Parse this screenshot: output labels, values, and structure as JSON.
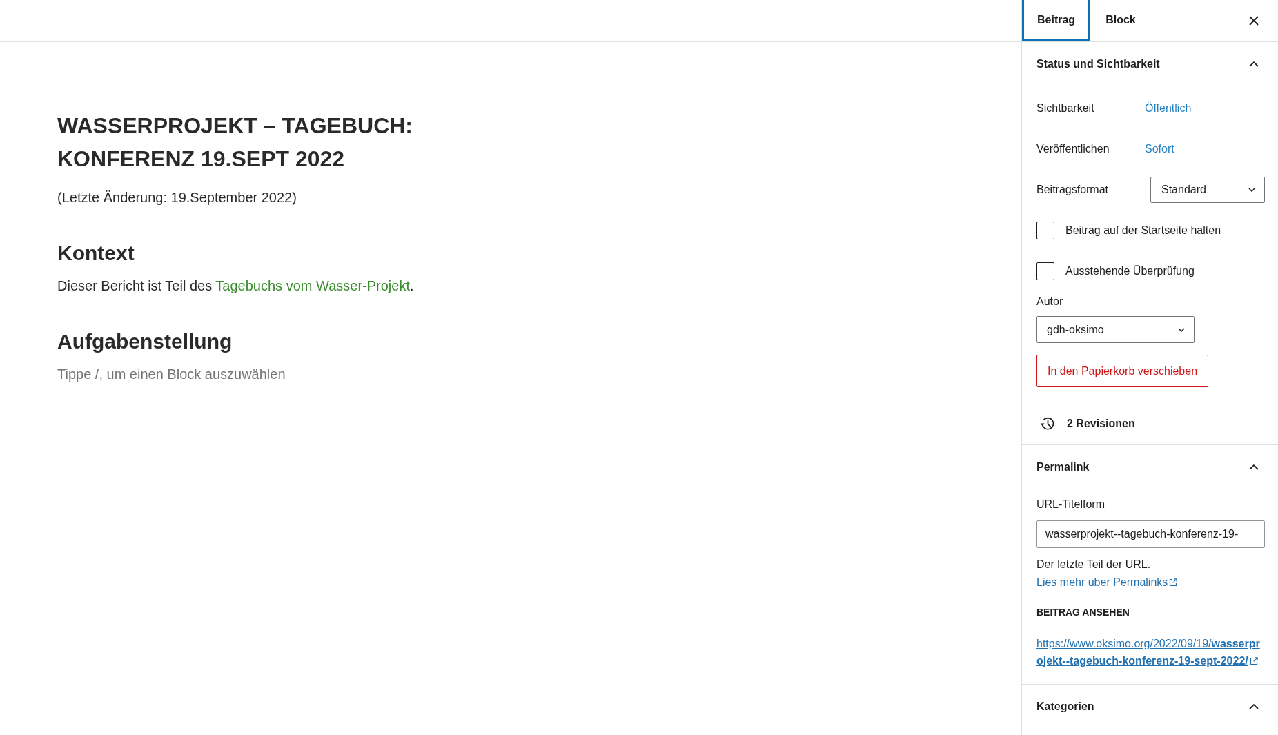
{
  "editor": {
    "title": "WASSERPROJEKT – TAGEBUCH: KONFERENZ 19.SEPT 2022",
    "blocks": [
      {
        "kind": "paragraph",
        "text": "(Letzte Änderung: 19.September 2022)"
      },
      {
        "kind": "heading",
        "text": "Kontext"
      },
      {
        "kind": "paragraph",
        "text": "Dieser Bericht ist Teil des ",
        "link": "Tagebuchs vom Wasser-Projekt",
        "after": "."
      },
      {
        "kind": "heading",
        "text": "Aufgabenstellung"
      },
      {
        "kind": "empty",
        "placeholder": "Tippe /, um einen Block auszuwählen"
      }
    ]
  },
  "sidebar": {
    "tabs": [
      {
        "label": "Beitrag",
        "selected": true
      },
      {
        "label": "Block",
        "selected": false
      }
    ],
    "panels": [
      {
        "kind": "collapsible",
        "title": "Status und Sichtbarkeit",
        "expanded": true,
        "rows": [
          {
            "kind": "link_value",
            "label": "Sichtbarkeit",
            "value": "Öffentlich"
          },
          {
            "kind": "link_value",
            "label": "Veröffentlichen",
            "value": "Sofort"
          },
          {
            "kind": "select",
            "label": "Beitragsformat",
            "value": "Standard"
          },
          {
            "kind": "checkbox",
            "label": "Beitrag auf der Startseite halten",
            "checked": false
          },
          {
            "kind": "checkbox",
            "label": "Ausstehende Überprüfung",
            "checked": false
          },
          {
            "kind": "field_label",
            "text": "Autor"
          },
          {
            "kind": "dropdown",
            "value": "gdh-oksimo"
          },
          {
            "kind": "danger_button",
            "label": "In den Papierkorb verschieben"
          }
        ]
      },
      {
        "kind": "link_row",
        "label": "2 Revisionen"
      },
      {
        "kind": "collapsible",
        "title": "Permalink",
        "expanded": true,
        "rows": [
          {
            "kind": "field_label",
            "text": "URL-Titelform"
          },
          {
            "kind": "text_field",
            "value": "wasserprojekt--tagebuch-konferenz-19-"
          },
          {
            "kind": "help",
            "text": "Der letzte Teil der URL. ",
            "link": "Lies mehr über Permalinks"
          },
          {
            "kind": "subheading",
            "text": "BEITRAG ANSEHEN"
          },
          {
            "kind": "url",
            "text": "https://www.oksimo.org/2022/09/19/**wasserprojekt--tagebuch-konferenz-19-sept-2022/**"
          }
        ]
      },
      {
        "kind": "collapsible",
        "title": "Kategorien",
        "expanded": true
      }
    ]
  }
}
